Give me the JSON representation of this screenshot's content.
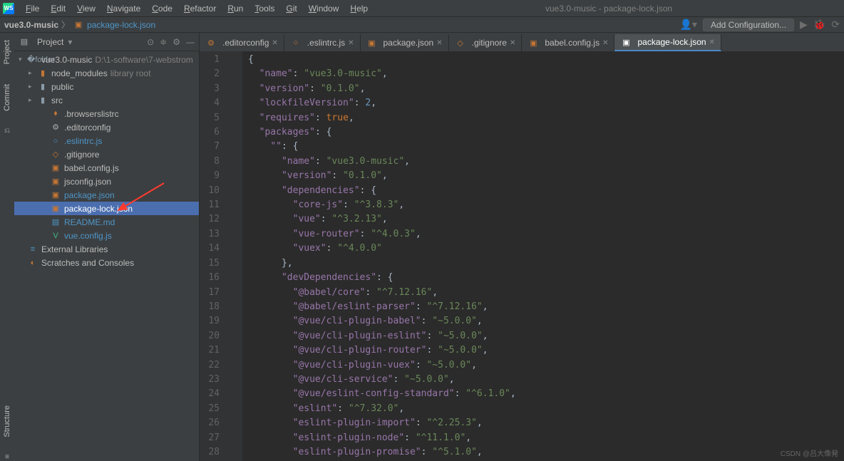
{
  "window": {
    "title": "vue3.0-music - package-lock.json"
  },
  "menu": [
    "File",
    "Edit",
    "View",
    "Navigate",
    "Code",
    "Refactor",
    "Run",
    "Tools",
    "Git",
    "Window",
    "Help"
  ],
  "breadcrumb": {
    "project": "vue3.0-music",
    "file": "package-lock.json",
    "add_config": "Add Configuration..."
  },
  "project_pane": {
    "title": "Project",
    "root": {
      "name": "vue3.0-music",
      "path": "D:\\1-software\\7-webstrom"
    },
    "folders": [
      {
        "name": "node_modules",
        "tag": "library root"
      },
      {
        "name": "public"
      },
      {
        "name": "src"
      }
    ],
    "files": [
      ".browserslistrc",
      ".editorconfig",
      ".eslintrc.js",
      ".gitignore",
      "babel.config.js",
      "jsconfig.json",
      "package.json",
      "package-lock.json",
      "README.md",
      "vue.config.js"
    ],
    "selected": "package-lock.json",
    "ext_libs": "External Libraries",
    "scratches": "Scratches and Consoles"
  },
  "tabs": [
    {
      "label": ".editorconfig",
      "icon": "⚙",
      "active": false
    },
    {
      "label": ".eslintrc.js",
      "icon": "○",
      "active": false
    },
    {
      "label": "package.json",
      "icon": "▣",
      "active": false
    },
    {
      "label": ".gitignore",
      "icon": "◇",
      "active": false
    },
    {
      "label": "babel.config.js",
      "icon": "▣",
      "active": false
    },
    {
      "label": "package-lock.json",
      "icon": "▣",
      "active": true
    }
  ],
  "side_tabs": {
    "project": "Project",
    "commit": "Commit",
    "structure": "Structure"
  },
  "code_lines": [
    [
      [
        "p",
        "{"
      ]
    ],
    [
      [
        "p",
        "  "
      ],
      [
        "k",
        "\"name\""
      ],
      [
        "p",
        ": "
      ],
      [
        "s",
        "\"vue3.0-music\""
      ],
      [
        "p",
        ","
      ]
    ],
    [
      [
        "p",
        "  "
      ],
      [
        "k",
        "\"version\""
      ],
      [
        "p",
        ": "
      ],
      [
        "s",
        "\"0.1.0\""
      ],
      [
        "p",
        ","
      ]
    ],
    [
      [
        "p",
        "  "
      ],
      [
        "k",
        "\"lockfileVersion\""
      ],
      [
        "p",
        ": "
      ],
      [
        "n",
        "2"
      ],
      [
        "p",
        ","
      ]
    ],
    [
      [
        "p",
        "  "
      ],
      [
        "k",
        "\"requires\""
      ],
      [
        "p",
        ": "
      ],
      [
        "b",
        "true"
      ],
      [
        "p",
        ","
      ]
    ],
    [
      [
        "p",
        "  "
      ],
      [
        "k",
        "\"packages\""
      ],
      [
        "p",
        ": {"
      ]
    ],
    [
      [
        "p",
        "    "
      ],
      [
        "k",
        "\"\""
      ],
      [
        "p",
        ": {"
      ]
    ],
    [
      [
        "p",
        "      "
      ],
      [
        "k",
        "\"name\""
      ],
      [
        "p",
        ": "
      ],
      [
        "s",
        "\"vue3.0-music\""
      ],
      [
        "p",
        ","
      ]
    ],
    [
      [
        "p",
        "      "
      ],
      [
        "k",
        "\"version\""
      ],
      [
        "p",
        ": "
      ],
      [
        "s",
        "\"0.1.0\""
      ],
      [
        "p",
        ","
      ]
    ],
    [
      [
        "p",
        "      "
      ],
      [
        "k",
        "\"dependencies\""
      ],
      [
        "p",
        ": {"
      ]
    ],
    [
      [
        "p",
        "        "
      ],
      [
        "k",
        "\"core-js\""
      ],
      [
        "p",
        ": "
      ],
      [
        "s",
        "\"^3.8.3\""
      ],
      [
        "p",
        ","
      ]
    ],
    [
      [
        "p",
        "        "
      ],
      [
        "k",
        "\"vue\""
      ],
      [
        "p",
        ": "
      ],
      [
        "s",
        "\"^3.2.13\""
      ],
      [
        "p",
        ","
      ]
    ],
    [
      [
        "p",
        "        "
      ],
      [
        "k",
        "\"vue-router\""
      ],
      [
        "p",
        ": "
      ],
      [
        "s",
        "\"^4.0.3\""
      ],
      [
        "p",
        ","
      ]
    ],
    [
      [
        "p",
        "        "
      ],
      [
        "k",
        "\"vuex\""
      ],
      [
        "p",
        ": "
      ],
      [
        "s",
        "\"^4.0.0\""
      ]
    ],
    [
      [
        "p",
        "      },"
      ]
    ],
    [
      [
        "p",
        "      "
      ],
      [
        "k",
        "\"devDependencies\""
      ],
      [
        "p",
        ": {"
      ]
    ],
    [
      [
        "p",
        "        "
      ],
      [
        "k",
        "\"@babel/core\""
      ],
      [
        "p",
        ": "
      ],
      [
        "s",
        "\"^7.12.16\""
      ],
      [
        "p",
        ","
      ]
    ],
    [
      [
        "p",
        "        "
      ],
      [
        "k",
        "\"@babel/eslint-parser\""
      ],
      [
        "p",
        ": "
      ],
      [
        "s",
        "\"^7.12.16\""
      ],
      [
        "p",
        ","
      ]
    ],
    [
      [
        "p",
        "        "
      ],
      [
        "k",
        "\"@vue/cli-plugin-babel\""
      ],
      [
        "p",
        ": "
      ],
      [
        "s",
        "\"~5.0.0\""
      ],
      [
        "p",
        ","
      ]
    ],
    [
      [
        "p",
        "        "
      ],
      [
        "k",
        "\"@vue/cli-plugin-eslint\""
      ],
      [
        "p",
        ": "
      ],
      [
        "s",
        "\"~5.0.0\""
      ],
      [
        "p",
        ","
      ]
    ],
    [
      [
        "p",
        "        "
      ],
      [
        "k",
        "\"@vue/cli-plugin-router\""
      ],
      [
        "p",
        ": "
      ],
      [
        "s",
        "\"~5.0.0\""
      ],
      [
        "p",
        ","
      ]
    ],
    [
      [
        "p",
        "        "
      ],
      [
        "k",
        "\"@vue/cli-plugin-vuex\""
      ],
      [
        "p",
        ": "
      ],
      [
        "s",
        "\"~5.0.0\""
      ],
      [
        "p",
        ","
      ]
    ],
    [
      [
        "p",
        "        "
      ],
      [
        "k",
        "\"@vue/cli-service\""
      ],
      [
        "p",
        ": "
      ],
      [
        "s",
        "\"~5.0.0\""
      ],
      [
        "p",
        ","
      ]
    ],
    [
      [
        "p",
        "        "
      ],
      [
        "k",
        "\"@vue/eslint-config-standard\""
      ],
      [
        "p",
        ": "
      ],
      [
        "s",
        "\"^6.1.0\""
      ],
      [
        "p",
        ","
      ]
    ],
    [
      [
        "p",
        "        "
      ],
      [
        "k",
        "\"eslint\""
      ],
      [
        "p",
        ": "
      ],
      [
        "s",
        "\"^7.32.0\""
      ],
      [
        "p",
        ","
      ]
    ],
    [
      [
        "p",
        "        "
      ],
      [
        "k",
        "\"eslint-plugin-import\""
      ],
      [
        "p",
        ": "
      ],
      [
        "s",
        "\"^2.25.3\""
      ],
      [
        "p",
        ","
      ]
    ],
    [
      [
        "p",
        "        "
      ],
      [
        "k",
        "\"eslint-plugin-node\""
      ],
      [
        "p",
        ": "
      ],
      [
        "s",
        "\"^11.1.0\""
      ],
      [
        "p",
        ","
      ]
    ],
    [
      [
        "p",
        "        "
      ],
      [
        "k",
        "\"eslint-plugin-promise\""
      ],
      [
        "p",
        ": "
      ],
      [
        "s",
        "\"^5.1.0\""
      ],
      [
        "p",
        ","
      ]
    ]
  ],
  "watermark": "CSDN @吕大像発"
}
